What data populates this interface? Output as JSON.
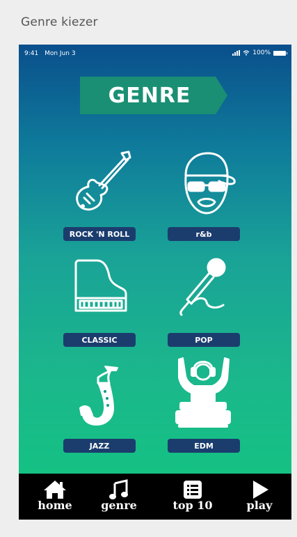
{
  "window": {
    "title": "Genre kiezer"
  },
  "status_bar": {
    "time": "9:41",
    "date": "Mon Jun 3",
    "battery": "100%"
  },
  "header": {
    "title": "GENRE"
  },
  "genres": [
    {
      "label": "ROCK 'N ROLL",
      "icon": "electric-guitar-icon"
    },
    {
      "label": "r&b",
      "icon": "cap-sunglasses-face-icon"
    },
    {
      "label": "CLASSIC",
      "icon": "grand-piano-icon"
    },
    {
      "label": "POP",
      "icon": "microphone-icon"
    },
    {
      "label": "JAZZ",
      "icon": "saxophone-icon"
    },
    {
      "label": "EDM",
      "icon": "dj-turntable-icon"
    }
  ],
  "nav": {
    "home": "home",
    "genre": "genre",
    "top10": "top 10",
    "play": "play"
  },
  "colors": {
    "label_bg": "#1b3d6e",
    "banner_bg": "#1a8f74",
    "nav_bg": "#000000"
  }
}
